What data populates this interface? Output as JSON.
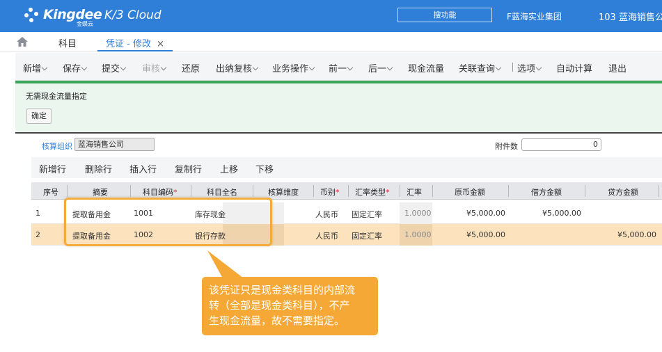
{
  "header": {
    "logo_text": "Kingdee",
    "logo_sub": "金蝶云",
    "product": "K/3 Cloud",
    "search_label": "搜功能",
    "org_group": "F蓝海实业集团",
    "org_current": "103 蓝海销售公"
  },
  "tabs": {
    "kemu": "科目",
    "active": "凭证 - 修改",
    "close": "×"
  },
  "toolbar": {
    "items": [
      "新增",
      "保存",
      "提交",
      "审核",
      "还原",
      "出纳复核",
      "业务操作",
      "前一",
      "后一",
      "现金流量",
      "关联查询",
      "选项",
      "自动计算",
      "退出"
    ]
  },
  "message": {
    "text": "无需现金流量指定",
    "ok": "确定"
  },
  "form": {
    "org_label": "核算组织",
    "org_value": "蓝海销售公司",
    "attach_label": "附件数",
    "attach_value": "0"
  },
  "row_actions": [
    "新增行",
    "删除行",
    "插入行",
    "复制行",
    "上移",
    "下移"
  ],
  "grid": {
    "headers": [
      "序号",
      "摘要",
      "科目编码",
      "科目全名",
      "核算维度",
      "币别",
      "汇率类型",
      "汇率",
      "原币金额",
      "借方金额",
      "贷方金额"
    ],
    "required_mark": "*",
    "rows": [
      {
        "no": "1",
        "summary": "提取备用金",
        "code": "1001",
        "name": "库存现金",
        "dim": "",
        "currency": "人民币",
        "rate_type": "固定汇率",
        "rate": "1.0000",
        "orig": "¥5,000.00",
        "debit": "¥5,000.00",
        "credit": ""
      },
      {
        "no": "2",
        "summary": "提取备用金",
        "code": "1002",
        "name": "银行存款",
        "dim": "",
        "currency": "人民币",
        "rate_type": "固定汇率",
        "rate": "1.0000",
        "orig": "¥5,000.00",
        "debit": "",
        "credit": "¥5,000.00"
      }
    ]
  },
  "callout": {
    "line1": "该凭证只是现金类科目的内部流",
    "line2": "转（全部是现金类科目），不产",
    "line3": "生现金流量，故不需要指定。"
  },
  "colors": {
    "brand": "#2f7fd9",
    "success_bar": "#3aa75b",
    "highlight": "#f5aa3c",
    "selected_row": "#fde3bd"
  }
}
